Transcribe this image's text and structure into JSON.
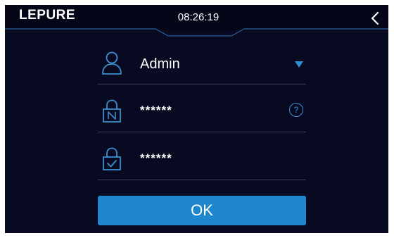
{
  "header": {
    "logo_text": "LEPURE",
    "time": "08:26:19",
    "back_icon": "chevron-left-icon"
  },
  "form": {
    "user": {
      "icon": "user-icon",
      "value": "Admin",
      "dropdown_icon": "triangle-down-icon"
    },
    "new_password": {
      "icon": "lock-n-icon",
      "masked_value": "******",
      "help_label": "?"
    },
    "confirm_password": {
      "icon": "lock-check-icon",
      "masked_value": "******"
    },
    "ok_label": "OK"
  },
  "colors": {
    "background": "#080a22",
    "header": "#050719",
    "accent": "#1e86cd",
    "icon": "#3d8fd0",
    "divider": "#3a3f58",
    "text": "#ffffff"
  }
}
